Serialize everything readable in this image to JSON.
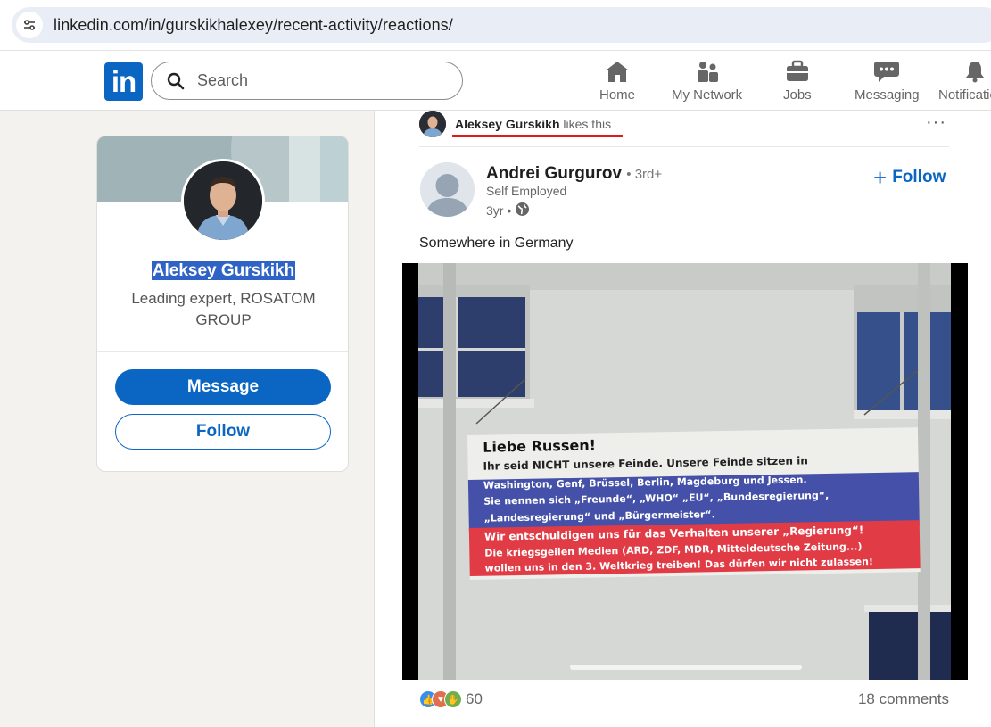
{
  "browser": {
    "url": "linkedin.com/in/gurskikhalexey/recent-activity/reactions/"
  },
  "nav": {
    "logo": "in",
    "search_placeholder": "Search",
    "items": [
      {
        "label": "Home",
        "icon": "home-icon"
      },
      {
        "label": "My Network",
        "icon": "people-icon"
      },
      {
        "label": "Jobs",
        "icon": "briefcase-icon"
      },
      {
        "label": "Messaging",
        "icon": "chat-icon"
      },
      {
        "label": "Notifications",
        "icon": "bell-icon"
      }
    ]
  },
  "profile": {
    "name": "Aleksey Gurskikh",
    "headline": "Leading expert, ROSATOM GROUP",
    "message_label": "Message",
    "follow_label": "Follow"
  },
  "activity": {
    "actor": "Aleksey Gurskikh",
    "action": "likes this",
    "more": "···"
  },
  "post": {
    "author": "Andrei Gurgurov",
    "degree": "• 3rd+",
    "subtitle": "Self Employed",
    "time": "3yr •",
    "follow_label": "Follow",
    "text": "Somewhere in Germany",
    "banner": {
      "heading": "Liebe Russen!",
      "line1": "Ihr seid NICHT unsere Feinde. Unsere Feinde sitzen in",
      "line2": "Washington, Genf, Brüssel, Berlin, Magdeburg und Jessen.",
      "line3": "Sie nennen sich „Freunde“, „WHO“ „EU“, „Bundesregierung“,",
      "line4": "„Landesregierung“ und „Bürgermeister“.",
      "line5": "Wir entschuldigen uns für das Verhalten unserer „Regierung“!",
      "line6": "Die kriegsgeilen Medien (ARD, ZDF, MDR, Mitteldeutsche Zeitung...)",
      "line7": "wollen uns in den 3. Weltkrieg treiben! Das dürfen wir nicht zulassen!"
    },
    "reactions_count": "60",
    "comments": "18 comments"
  },
  "colors": {
    "brand": "#0a66c2",
    "highlight": "#2f63c6",
    "annotation_red": "#e01a1a"
  }
}
